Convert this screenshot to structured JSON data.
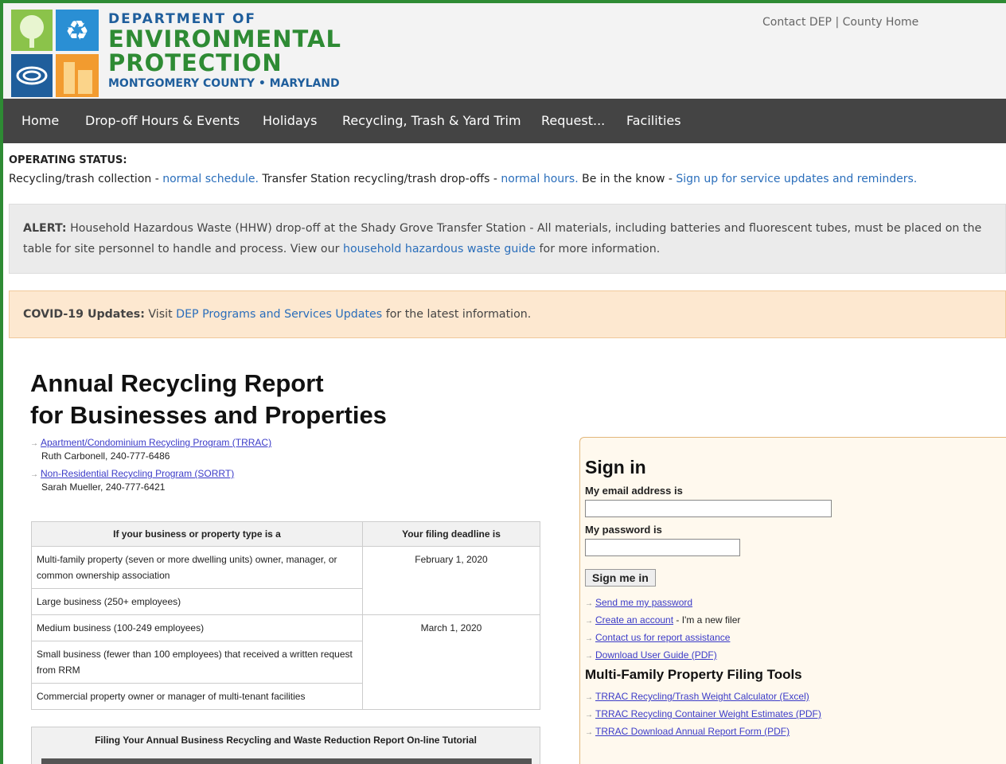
{
  "brand": {
    "line1": "DEPARTMENT OF",
    "line2": "ENVIRONMENTAL",
    "line3": "PROTECTION",
    "line4": "MONTGOMERY COUNTY • MARYLAND",
    "green": "#2e8b34",
    "blue": "#1f5e9c"
  },
  "toplinks": {
    "contact": "Contact DEP",
    "separator": "|",
    "county": "County Home"
  },
  "nav": {
    "items": [
      "Home",
      "Drop-off Hours & Events",
      "Holidays",
      "Recycling, Trash & Yard Trim",
      "Request...",
      "Facilities"
    ]
  },
  "status": {
    "title": "OPERATING STATUS:",
    "part1": "Recycling/trash collection - ",
    "link1": "normal schedule.",
    "part2": " Transfer Station recycling/trash drop-offs - ",
    "link2": "normal hours.",
    "part3": " Be in the know - ",
    "link3": "Sign up for service updates and reminders."
  },
  "alert": {
    "label": "ALERT:",
    "text1": " Household Hazardous Waste (HHW) drop-off at the Shady Grove Transfer Station - All materials, including batteries and fluorescent tubes, must be placed on the table for site personnel to handle and process. View our ",
    "link": "household hazardous waste guide",
    "text2": " for more information."
  },
  "covid": {
    "label": "COVID-19 Updates:",
    "text1": " Visit ",
    "link": "DEP Programs and Services Updates",
    "text2": " for the latest information."
  },
  "main": {
    "title_line1": "Annual Recycling Report",
    "title_line2": "for Businesses and Properties"
  },
  "contacts": [
    {
      "program": "Apartment/Condominium Recycling Program (TRRAC)",
      "person": "Ruth Carbonell, 240-777-6486"
    },
    {
      "program": "Non-Residential Recycling Program (SORRT)",
      "person": "Sarah Mueller, 240-777-6421"
    }
  ],
  "table": {
    "col1": "If your business or property type is a",
    "col2": "Your filing deadline is",
    "rows": [
      "Multi-family property (seven or more dwelling units) owner, manager, or common ownership association",
      "Large business (250+ employees)",
      "Medium business (100-249 employees)",
      "Small business (fewer than 100 employees) that received a written request from RRM",
      "Commercial property owner or manager of multi-tenant facilities"
    ],
    "dates": [
      "February 1, 2020",
      "March 1, 2020"
    ]
  },
  "tutorial": {
    "title": "Filing Your Annual Business Recycling and Waste Reduction Report On-line Tutorial"
  },
  "signin": {
    "title": "Sign in",
    "email_label": "My email address is",
    "password_label": "My password is",
    "button": "Sign me in",
    "links": [
      {
        "text": "Send me my password",
        "suffix": ""
      },
      {
        "text": "Create an account",
        "suffix": " - I'm a new filer"
      },
      {
        "text": "Contact us for report assistance",
        "suffix": ""
      },
      {
        "text": "Download User Guide (PDF)",
        "suffix": ""
      }
    ],
    "tools_title": "Multi-Family Property Filing Tools",
    "tools": [
      "TRRAC Recycling/Trash Weight Calculator (Excel)",
      "TRRAC Recycling Container Weight Estimates (PDF)",
      "TRRAC Download Annual Report Form (PDF)"
    ]
  }
}
